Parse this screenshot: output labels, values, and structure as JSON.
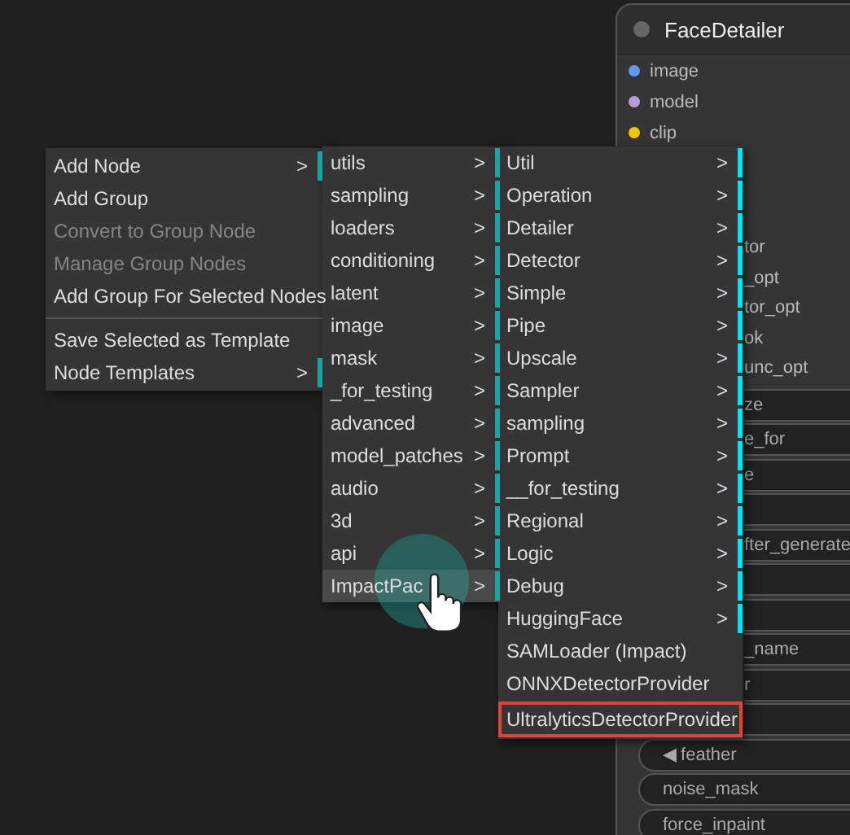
{
  "node": {
    "title": "FaceDetailer",
    "inputs": [
      {
        "label": "image",
        "color": "#5b9bf0"
      },
      {
        "label": "model",
        "color": "#b39ddb"
      },
      {
        "label": "clip",
        "color": "#f5c400"
      }
    ],
    "slots": [
      {
        "label": "tor",
        "partly_hidden": true
      },
      {
        "label": "_opt",
        "partly_hidden": true
      },
      {
        "label": "tor_opt",
        "partly_hidden": true
      },
      {
        "label": "ok",
        "partly_hidden": true
      },
      {
        "label": "unc_opt",
        "partly_hidden": true
      }
    ],
    "widgets": [
      {
        "label": "ze",
        "partly_hidden": true
      },
      {
        "label": "e_for",
        "partly_hidden": true
      },
      {
        "label": "e",
        "partly_hidden": true
      },
      {
        "partly_hidden": true
      },
      {
        "label": "fter_generate",
        "partly_hidden": true
      },
      {
        "partly_hidden": true
      },
      {
        "partly_hidden": true
      },
      {
        "label": "_name",
        "partly_hidden": true
      },
      {
        "label": "r",
        "partly_hidden": true
      },
      {
        "partly_hidden": true
      },
      {
        "label": "◀ feather",
        "partly_hidden": false
      },
      {
        "label": "noise_mask",
        "partly_hidden": false
      },
      {
        "label": "force_inpaint",
        "partly_hidden": false
      }
    ]
  },
  "context_menu": {
    "groups": [
      [
        {
          "label": "Add Node",
          "arrow": ">",
          "disabled": false
        },
        {
          "label": "Add Group",
          "disabled": false
        },
        {
          "label": "Convert to Group Node",
          "disabled": true
        },
        {
          "label": "Manage Group Nodes",
          "disabled": true
        },
        {
          "label": "Add Group For Selected Nodes",
          "disabled": false
        }
      ],
      [
        {
          "label": "Save Selected as Template",
          "disabled": false
        },
        {
          "label": "Node Templates",
          "arrow": ">",
          "disabled": false
        }
      ]
    ]
  },
  "category_menu": {
    "items": [
      {
        "label": "utils",
        "arrow": ">",
        "selected": false
      },
      {
        "label": "sampling",
        "arrow": ">",
        "selected": false
      },
      {
        "label": "loaders",
        "arrow": ">",
        "selected": false
      },
      {
        "label": "conditioning",
        "arrow": ">",
        "selected": false
      },
      {
        "label": "latent",
        "arrow": ">",
        "selected": false
      },
      {
        "label": "image",
        "arrow": ">",
        "selected": false
      },
      {
        "label": "mask",
        "arrow": ">",
        "selected": false
      },
      {
        "label": "_for_testing",
        "arrow": ">",
        "selected": false
      },
      {
        "label": "advanced",
        "arrow": ">",
        "selected": false
      },
      {
        "label": "model_patches",
        "arrow": ">",
        "selected": false
      },
      {
        "label": "audio",
        "arrow": ">",
        "selected": false
      },
      {
        "label": "3d",
        "arrow": ">",
        "selected": false
      },
      {
        "label": "api",
        "arrow": ">",
        "selected": false
      },
      {
        "label": "ImpactPac",
        "arrow": ">",
        "selected": true
      }
    ]
  },
  "impact_menu": {
    "items": [
      {
        "label": "Util",
        "arrow": ">",
        "highlighted": false
      },
      {
        "label": "Operation",
        "arrow": ">",
        "highlighted": false
      },
      {
        "label": "Detailer",
        "arrow": ">",
        "highlighted": false
      },
      {
        "label": "Detector",
        "arrow": ">",
        "highlighted": false
      },
      {
        "label": "Simple",
        "arrow": ">",
        "highlighted": false
      },
      {
        "label": "Pipe",
        "arrow": ">",
        "highlighted": false
      },
      {
        "label": "Upscale",
        "arrow": ">",
        "highlighted": false
      },
      {
        "label": "Sampler",
        "arrow": ">",
        "highlighted": false
      },
      {
        "label": "sampling",
        "arrow": ">",
        "highlighted": false
      },
      {
        "label": "Prompt",
        "arrow": ">",
        "highlighted": false
      },
      {
        "label": "__for_testing",
        "arrow": ">",
        "highlighted": false
      },
      {
        "label": "Regional",
        "arrow": ">",
        "highlighted": false
      },
      {
        "label": "Logic",
        "arrow": ">",
        "highlighted": false
      },
      {
        "label": "Debug",
        "arrow": ">",
        "highlighted": false
      },
      {
        "label": "HuggingFace",
        "arrow": ">",
        "highlighted": false
      },
      {
        "label": "SAMLoader (Impact)",
        "highlighted": false
      },
      {
        "label": "ONNXDetectorProvider",
        "highlighted": false
      },
      {
        "label": "UltralyticsDetectorProvider",
        "highlighted": true
      }
    ]
  }
}
